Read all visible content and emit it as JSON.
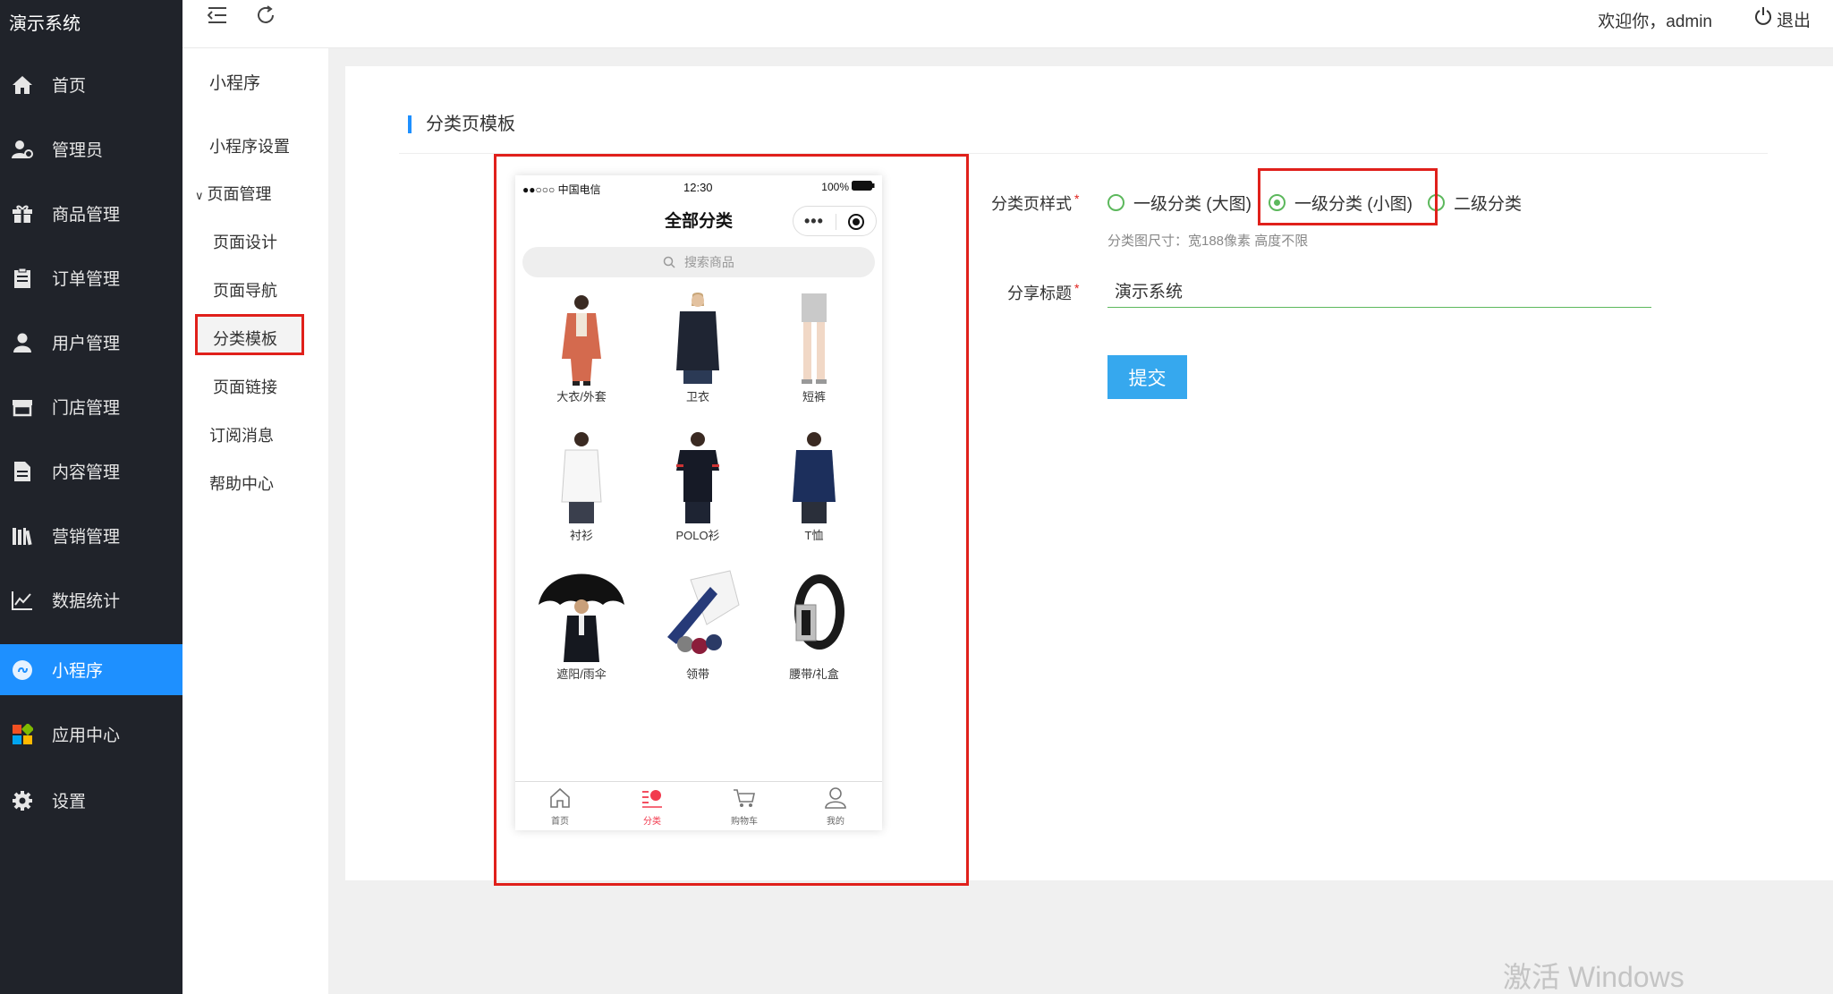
{
  "brand": "演示系统",
  "sidebar": {
    "items": [
      {
        "label": "首页",
        "icon": "home-icon"
      },
      {
        "label": "管理员",
        "icon": "admin-user-icon"
      },
      {
        "label": "商品管理",
        "icon": "gift-icon"
      },
      {
        "label": "订单管理",
        "icon": "clipboard-icon"
      },
      {
        "label": "用户管理",
        "icon": "user-icon"
      },
      {
        "label": "门店管理",
        "icon": "store-icon"
      },
      {
        "label": "内容管理",
        "icon": "document-icon"
      },
      {
        "label": "营销管理",
        "icon": "books-icon"
      },
      {
        "label": "数据统计",
        "icon": "line-chart-icon"
      },
      {
        "label": "小程序",
        "icon": "mini-program-icon",
        "active": true
      },
      {
        "label": "应用中心",
        "icon": "app-grid-icon"
      },
      {
        "label": "设置",
        "icon": "gear-icon"
      }
    ]
  },
  "subnav": {
    "title": "小程序",
    "items": [
      {
        "label": "小程序设置"
      },
      {
        "label": "页面管理",
        "expanded": true
      },
      {
        "label": "页面设计"
      },
      {
        "label": "页面导航"
      },
      {
        "label": "分类模板",
        "selected": true
      },
      {
        "label": "页面链接"
      },
      {
        "label": "订阅消息"
      },
      {
        "label": "帮助中心"
      }
    ]
  },
  "topbar": {
    "welcome": "欢迎你，admin",
    "logout": "退出"
  },
  "panel": {
    "title": "分类页模板"
  },
  "phone": {
    "carrier": "●●○○○ 中国电信",
    "time": "12:30",
    "battery": "100%",
    "title": "全部分类",
    "search_placeholder": "搜索商品",
    "categories": [
      {
        "label": "大衣/外套"
      },
      {
        "label": "卫衣"
      },
      {
        "label": "短裤"
      },
      {
        "label": "衬衫"
      },
      {
        "label": "POLO衫"
      },
      {
        "label": "T恤"
      },
      {
        "label": "遮阳/雨伞"
      },
      {
        "label": "领带"
      },
      {
        "label": "腰带/礼盒"
      }
    ],
    "tabs": [
      {
        "label": "首页",
        "icon": "home-icon"
      },
      {
        "label": "分类",
        "icon": "category-icon",
        "active": true
      },
      {
        "label": "购物车",
        "icon": "cart-icon"
      },
      {
        "label": "我的",
        "icon": "profile-icon"
      }
    ],
    "accent_color": "#f23a4e"
  },
  "form": {
    "style_label": "分类页样式",
    "options": [
      {
        "label": "一级分类 (大图)",
        "checked": false
      },
      {
        "label": "一级分类 (小图)",
        "checked": true
      },
      {
        "label": "二级分类",
        "checked": false
      }
    ],
    "hint": "分类图尺寸：宽188像素 高度不限",
    "share_label": "分享标题",
    "share_value": "演示系统",
    "submit": "提交"
  },
  "watermark": "激活 Windows",
  "colors": {
    "sidebar_bg": "#20232a",
    "active_blue": "#1e90ff",
    "highlight_red": "#e0201b",
    "radio_green": "#5cb85c",
    "submit_blue": "#36a8ee"
  }
}
